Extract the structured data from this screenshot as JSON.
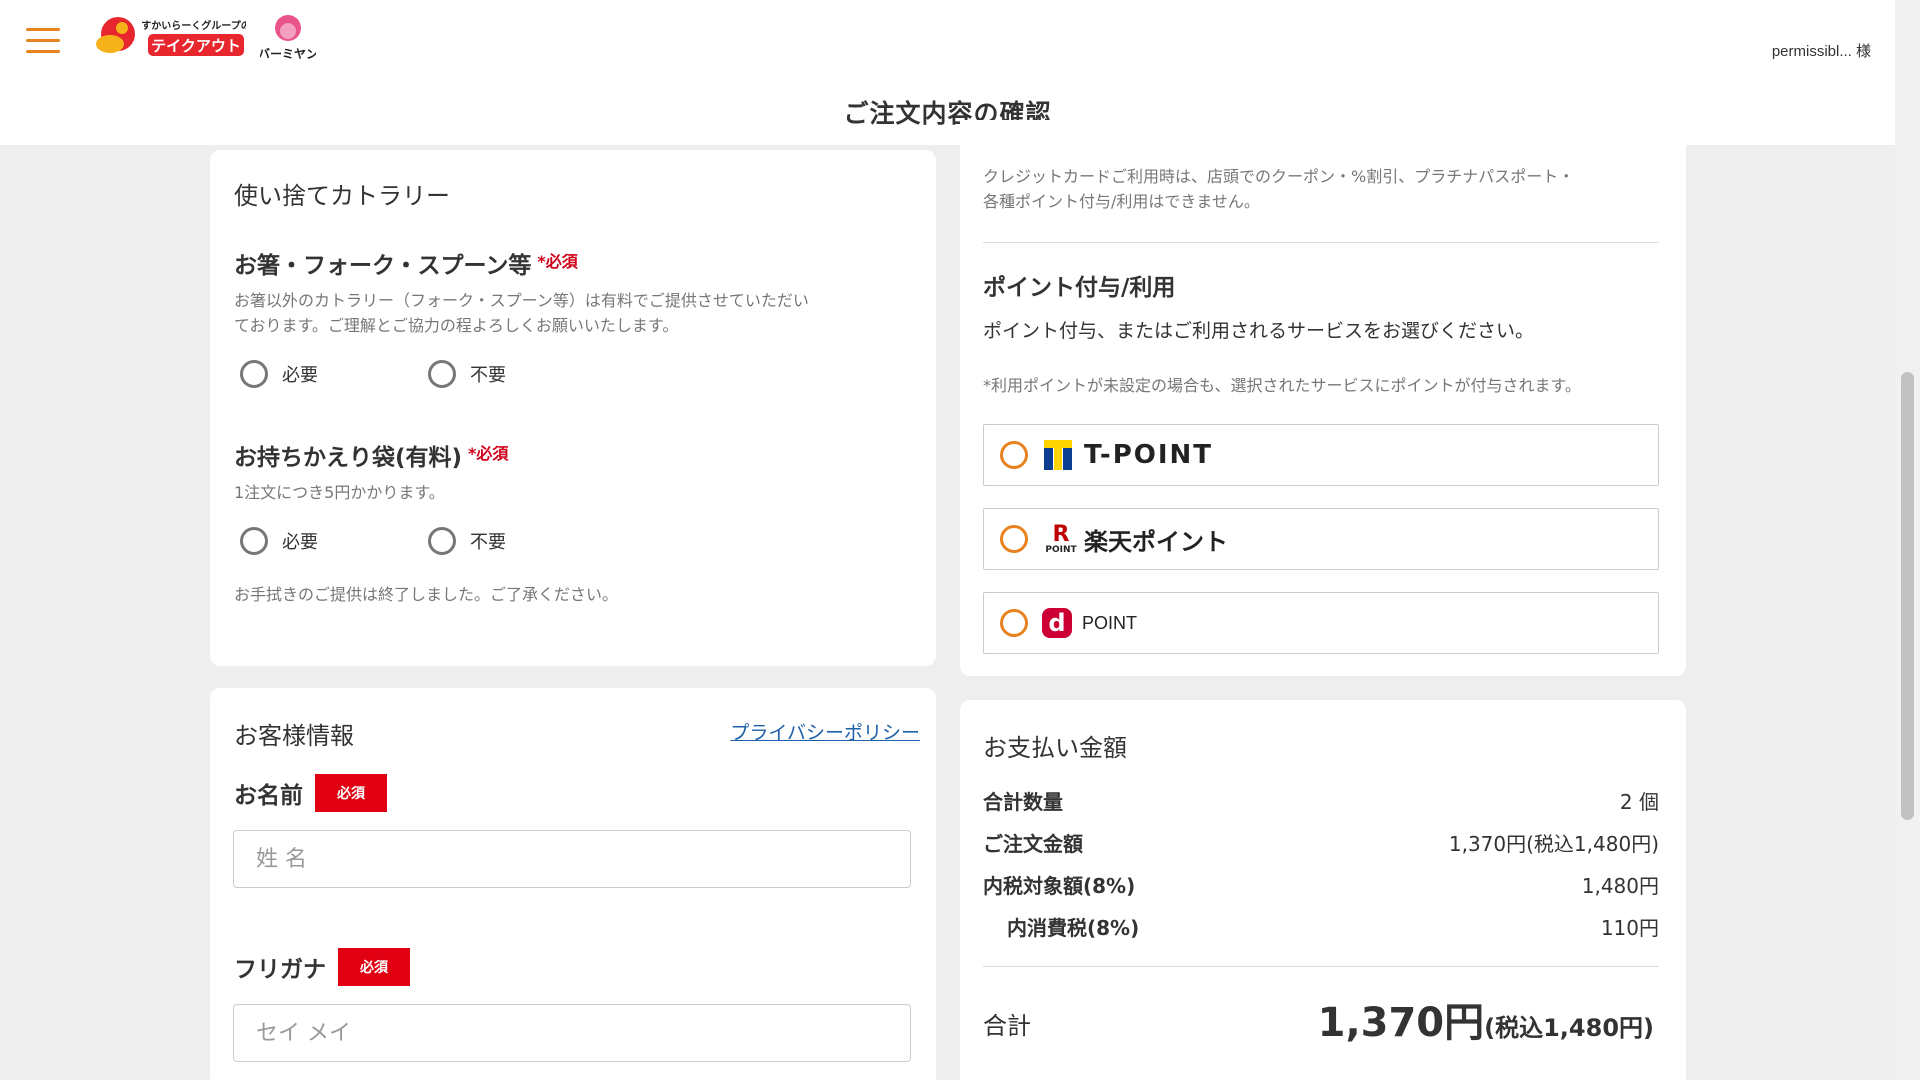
{
  "header": {
    "logo_text": "テイクアウト",
    "logo_group_text": "すかいらーくグループの",
    "logo2_text": "バーミヤン",
    "user_name": "permissibl... 様",
    "page_title": "ご注文内容の確認"
  },
  "cutlery": {
    "title": "使い捨てカトラリー",
    "q1": {
      "title": "お箸・フォーク・スプーン等",
      "required": "*必須",
      "desc_line1": "お箸以外のカトラリー（フォーク・スプーン等）は有料でご提供させていただい",
      "desc_line2": "ております。ご理解とご協力の程よろしくお願いいたします。",
      "option_need": "必要",
      "option_no": "不要"
    },
    "q2": {
      "title": "お持ちかえり袋(有料)",
      "required": "*必須",
      "desc": "1注文につき5円かかります。",
      "option_need": "必要",
      "option_no": "不要"
    },
    "note": "お手拭きのご提供は終了しました。ご了承ください。"
  },
  "points": {
    "credit_note_line1": "クレジットカードご利用時は、店頭でのクーポン・%割引、プラチナパスポート・",
    "credit_note_line2": "各種ポイント付与/利用はできません。",
    "title": "ポイント付与/利用",
    "desc": "ポイント付与、またはご利用されるサービスをお選びください。",
    "sub_note": "*利用ポイントが未設定の場合も、選択されたサービスにポイントが付与されます。",
    "options": [
      {
        "label": "T-POINT",
        "icon": "t-point-logo-icon"
      },
      {
        "label": "楽天ポイント",
        "icon_text": "R",
        "icon_sub": "POINT"
      },
      {
        "label": "POINT",
        "icon_text": "d",
        "icon": "d-point-logo-icon"
      }
    ],
    "colors": {
      "radio": "#e8821e",
      "tpoint_yellow": "#ffd400",
      "tpoint_blue": "#0b3d91",
      "rakuten_red": "#bf0000",
      "dpoint_red": "#cc0033"
    }
  },
  "customer": {
    "title": "お客様情報",
    "privacy_link": "プライバシーポリシー",
    "name_label": "お名前",
    "name_required": "必須",
    "name_placeholder": "姓 名",
    "kana_label": "フリガナ",
    "kana_required": "必須",
    "kana_placeholder": "セイ メイ"
  },
  "payment": {
    "title": "お支払い金額",
    "rows": [
      {
        "label": "合計数量",
        "value": "2 個"
      },
      {
        "label": "ご注文金額",
        "value": "1,370円(税込1,480円)"
      },
      {
        "label": "内税対象額(8%)",
        "value": "1,480円"
      },
      {
        "label": "内消費税(8%)",
        "value": "110円"
      }
    ],
    "total_label": "合計",
    "total_amount": "1,370円",
    "total_tax": "(税込1,480円)"
  }
}
